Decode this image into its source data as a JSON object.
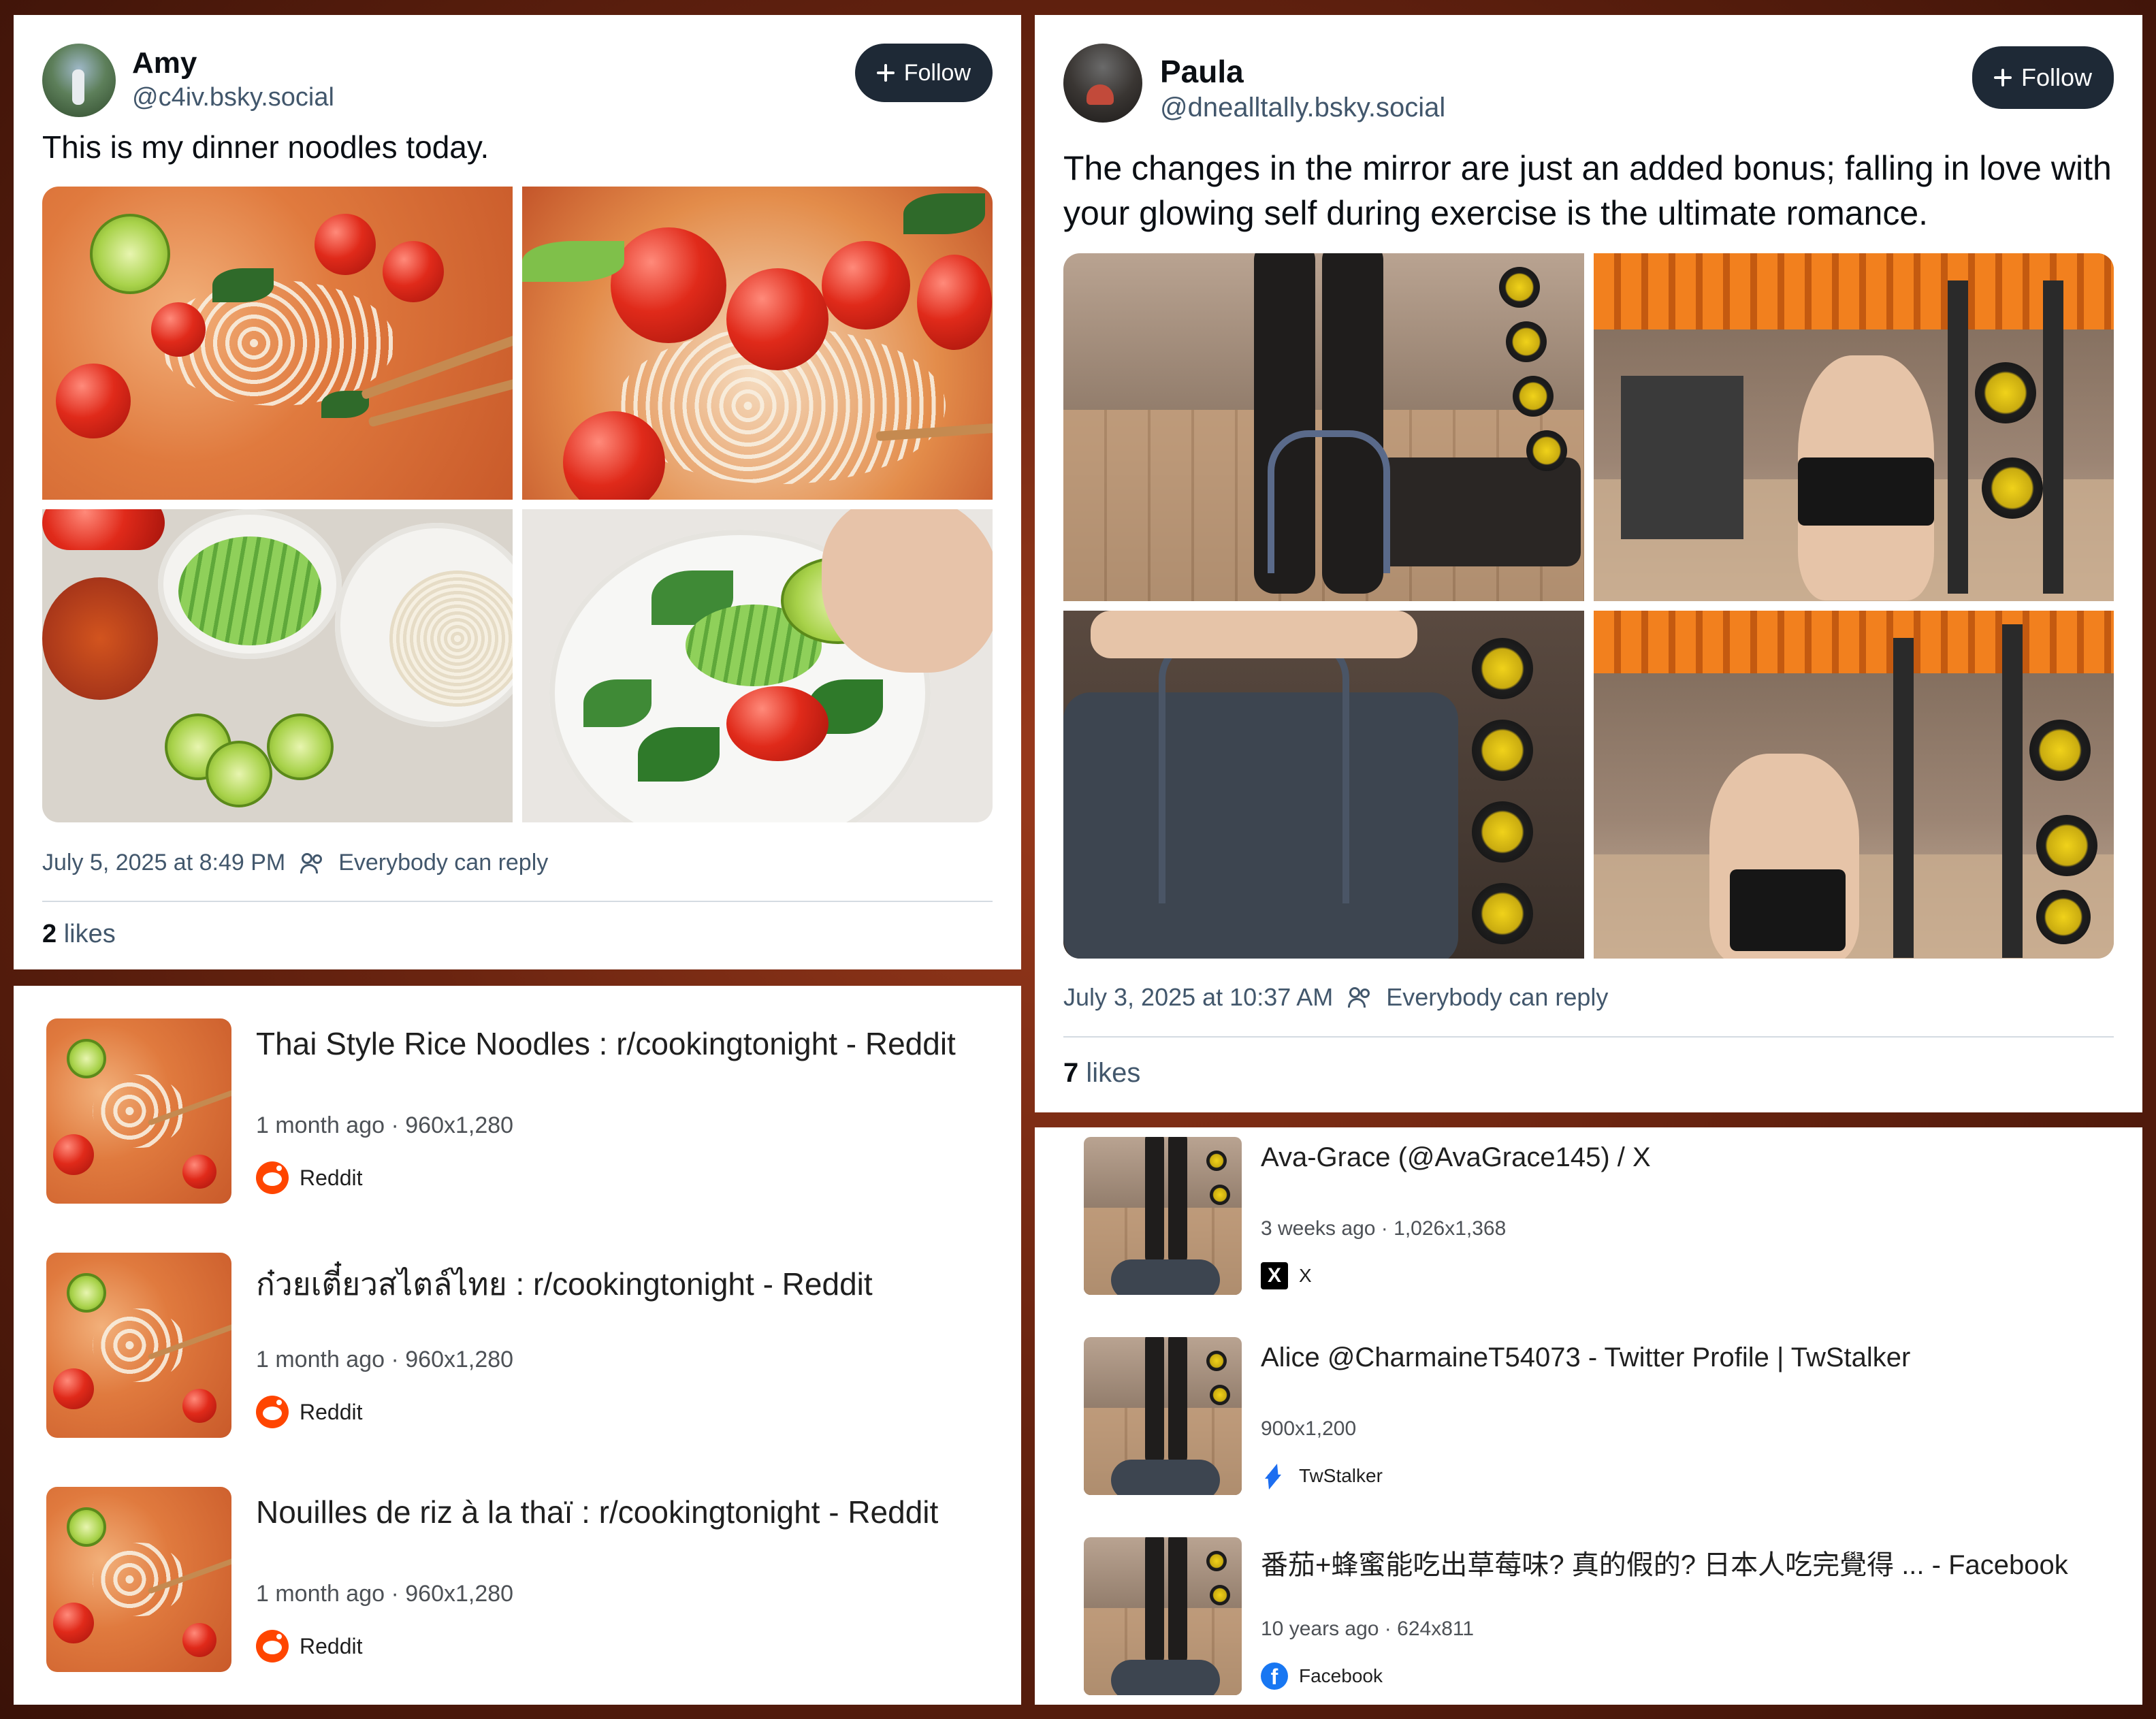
{
  "posts": [
    {
      "display_name": "Amy",
      "handle": "@c4iv.bsky.social",
      "follow_label": "Follow",
      "text": "This is my dinner noodles today.",
      "timestamp": "July 5, 2025 at 8:49 PM",
      "reply_setting": "Everybody can reply",
      "likes_count": "2",
      "likes_label": "likes"
    },
    {
      "display_name": "Paula",
      "handle": "@dnealltally.bsky.social",
      "follow_label": "Follow",
      "text": "The changes in the mirror are just an added bonus; falling in love with your glowing self during exercise is the ultimate romance.",
      "timestamp": "July 3, 2025 at 10:37 AM",
      "reply_setting": "Everybody can reply",
      "likes_count": "7",
      "likes_label": "likes"
    }
  ],
  "noodle_results": [
    {
      "title": "Thai Style Rice Noodles : r/cookingtonight - Reddit",
      "age": "1 month ago",
      "size": "960x1,280",
      "source": "Reddit",
      "icon": "reddit-icon"
    },
    {
      "title": "ก๋วยเตี๋ยวสไตล์ไทย : r/cookingtonight - Reddit",
      "age": "1 month ago",
      "size": "960x1,280",
      "source": "Reddit",
      "icon": "reddit-icon"
    },
    {
      "title": "Nouilles de riz à la thaï : r/cookingtonight - Reddit",
      "age": "1 month ago",
      "size": "960x1,280",
      "source": "Reddit",
      "icon": "reddit-icon"
    }
  ],
  "gym_results": [
    {
      "title": "Ava-Grace (@AvaGrace145) / X",
      "age": "3 weeks ago",
      "size": "1,026x1,368",
      "source": "X",
      "icon": "x-icon",
      "icon_glyph": "X"
    },
    {
      "title": "Alice @CharmaineT54073 - Twitter Profile | TwStalker",
      "age": "",
      "size": "900x1,200",
      "source": "TwStalker",
      "icon": "bolt-icon"
    },
    {
      "title": "番茄+蜂蜜能吃出草莓味?  真的假的? 日本人吃完覺得 ... - Facebook",
      "age": "10 years ago",
      "size": "624x811",
      "source": "Facebook",
      "icon": "facebook-icon",
      "icon_glyph": "f"
    }
  ],
  "separator": "·",
  "colors": {
    "follow_bg": "#1e2936",
    "muted_text": "#42576c",
    "reddit": "#ff4500",
    "facebook": "#1877f2"
  }
}
